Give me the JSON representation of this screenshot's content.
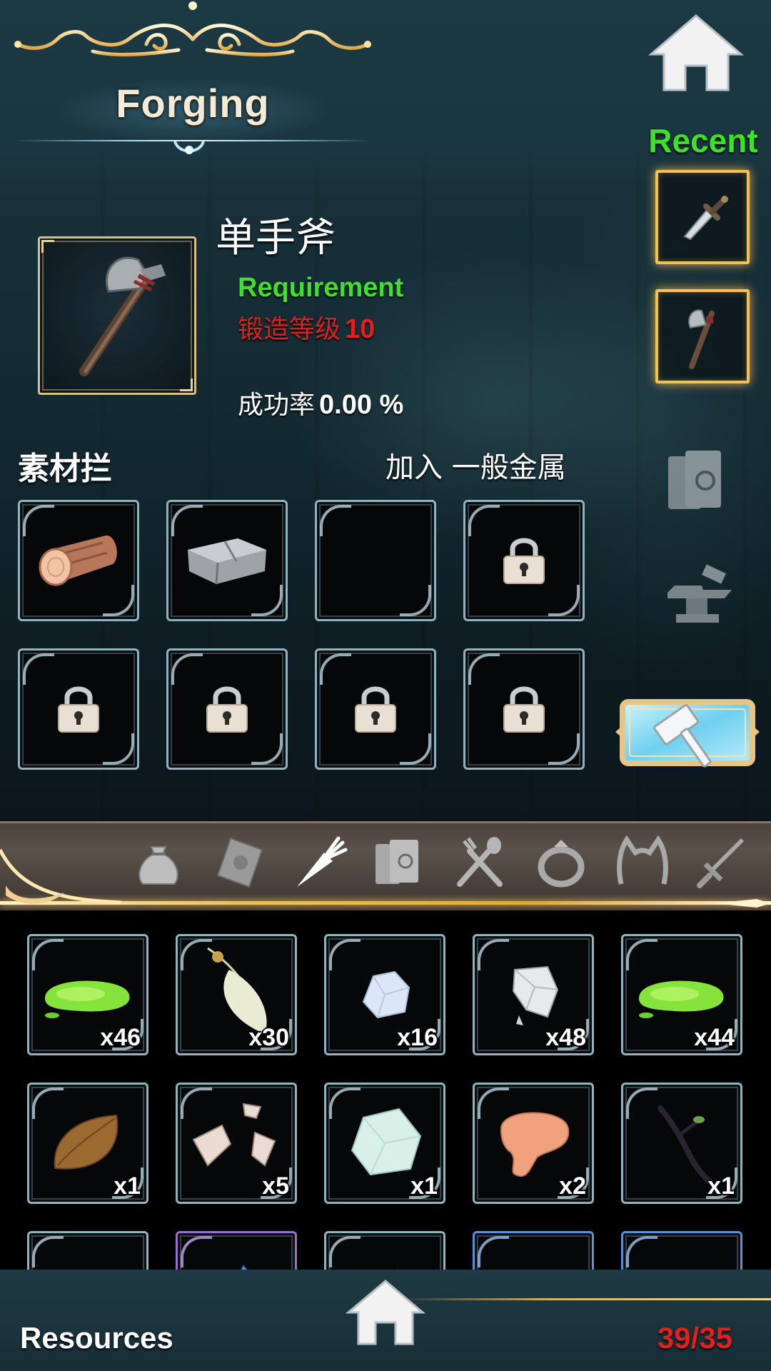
{
  "header": {
    "title": "Forging",
    "home_icon": "home-icon"
  },
  "recent": {
    "label": "Recent",
    "items": [
      {
        "icon": "dagger-icon"
      },
      {
        "icon": "axe-icon"
      }
    ]
  },
  "item": {
    "name": "单手斧",
    "icon": "axe-icon",
    "requirement_label": "Requirement",
    "requirement_text": "锻造等级",
    "requirement_level": "10",
    "success_label": "成功率",
    "success_value": "0.00 %"
  },
  "materials": {
    "title": "素材拦",
    "add_text": "加入  一般金属",
    "slots": [
      {
        "state": "filled",
        "icon": "log-icon"
      },
      {
        "state": "filled",
        "icon": "stone-slab-icon"
      },
      {
        "state": "empty"
      },
      {
        "state": "locked",
        "icon": "lock-icon"
      },
      {
        "state": "locked",
        "icon": "lock-icon"
      },
      {
        "state": "locked",
        "icon": "lock-icon"
      },
      {
        "state": "locked",
        "icon": "lock-icon"
      },
      {
        "state": "locked",
        "icon": "lock-icon"
      }
    ]
  },
  "side_icons": [
    "book-icon",
    "anvil-icon"
  ],
  "forge_button_icon": "hammer-icon",
  "categories": [
    {
      "icon": "bag-icon",
      "active": false
    },
    {
      "icon": "scroll-icon",
      "active": false
    },
    {
      "icon": "carrot-icon",
      "active": true
    },
    {
      "icon": "book-icon",
      "active": false
    },
    {
      "icon": "cutlery-icon",
      "active": false
    },
    {
      "icon": "ring-icon",
      "active": false
    },
    {
      "icon": "cat-ears-icon",
      "active": false
    },
    {
      "icon": "sword-icon",
      "active": false
    }
  ],
  "resources": {
    "row1": [
      {
        "icon": "green-slime-icon",
        "count": "x46"
      },
      {
        "icon": "feather-icon",
        "count": "x30"
      },
      {
        "icon": "crystal-ore-icon",
        "count": "x16"
      },
      {
        "icon": "silver-ore-icon",
        "count": "x48"
      },
      {
        "icon": "green-slime-icon",
        "count": "x44"
      }
    ],
    "row2": [
      {
        "icon": "brown-leaf-icon",
        "count": "x1"
      },
      {
        "icon": "bone-shards-icon",
        "count": "x5"
      },
      {
        "icon": "pale-crystal-icon",
        "count": "x1"
      },
      {
        "icon": "meat-icon",
        "count": "x2"
      },
      {
        "icon": "dark-branch-icon",
        "count": "x1"
      }
    ],
    "row3": [
      {
        "icon": "item-icon",
        "border": "default"
      },
      {
        "icon": "blue-crystal-icon",
        "border": "purple"
      },
      {
        "icon": "herb-icon",
        "border": "default"
      },
      {
        "icon": "metal-icon",
        "border": "blue"
      },
      {
        "icon": "item-icon",
        "border": "blue"
      }
    ]
  },
  "footer": {
    "label": "Resources",
    "count": "39/35"
  },
  "colors": {
    "green": "#3fe02a",
    "red": "#e01f1f",
    "gold": "#f4c153"
  }
}
